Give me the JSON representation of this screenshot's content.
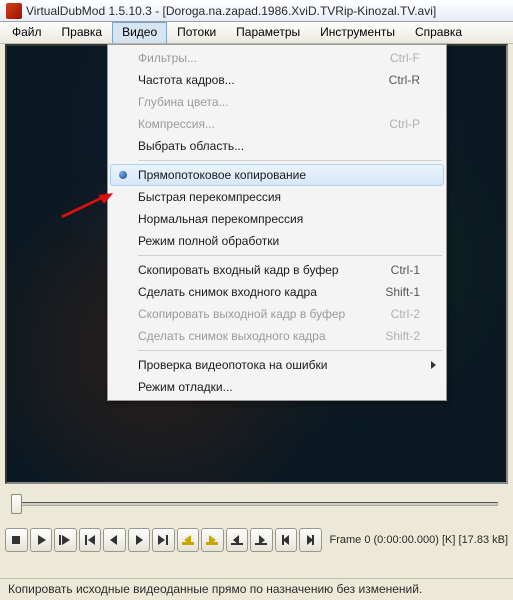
{
  "window": {
    "title": "VirtualDubMod 1.5.10.3 - [Doroga.na.zapad.1986.XviD.TVRip-Kinozal.TV.avi]"
  },
  "menubar": {
    "items": [
      "Файл",
      "Правка",
      "Видео",
      "Потоки",
      "Параметры",
      "Инструменты",
      "Справка"
    ],
    "active_index": 2
  },
  "dropdown": {
    "rows": [
      {
        "label": "Фильтры...",
        "shortcut": "Ctrl-F",
        "disabled": true
      },
      {
        "label": "Частота кадров...",
        "shortcut": "Ctrl-R",
        "disabled": false
      },
      {
        "label": "Глубина цвета...",
        "shortcut": "",
        "disabled": true
      },
      {
        "label": "Компрессия...",
        "shortcut": "Ctrl-P",
        "disabled": true
      },
      {
        "label": "Выбрать область...",
        "shortcut": "",
        "disabled": false
      },
      {
        "sep": true
      },
      {
        "label": "Прямопотоковое копирование",
        "shortcut": "",
        "disabled": false,
        "highlight": true,
        "bullet": true
      },
      {
        "label": "Быстрая перекомпрессия",
        "shortcut": "",
        "disabled": false
      },
      {
        "label": "Нормальная перекомпрессия",
        "shortcut": "",
        "disabled": false
      },
      {
        "label": "Режим полной обработки",
        "shortcut": "",
        "disabled": false
      },
      {
        "sep": true
      },
      {
        "label": "Скопировать входный кадр в буфер",
        "shortcut": "Ctrl-1",
        "disabled": false
      },
      {
        "label": "Сделать снимок входного кадра",
        "shortcut": "Shift-1",
        "disabled": false
      },
      {
        "label": "Скопировать выходной кадр в буфер",
        "shortcut": "Ctrl-2",
        "disabled": true
      },
      {
        "label": "Сделать снимок выходного кадра",
        "shortcut": "Shift-2",
        "disabled": true
      },
      {
        "sep": true
      },
      {
        "label": "Проверка видеопотока на ошибки",
        "shortcut": "",
        "disabled": false,
        "submenu": true
      },
      {
        "label": "Режим отладки...",
        "shortcut": "",
        "disabled": false
      }
    ]
  },
  "frame_info": "Frame 0 (0:00:00.000) [K] [17.83 kB]",
  "statusbar": "Копировать исходные видеоданные прямо по назначению без изменений."
}
